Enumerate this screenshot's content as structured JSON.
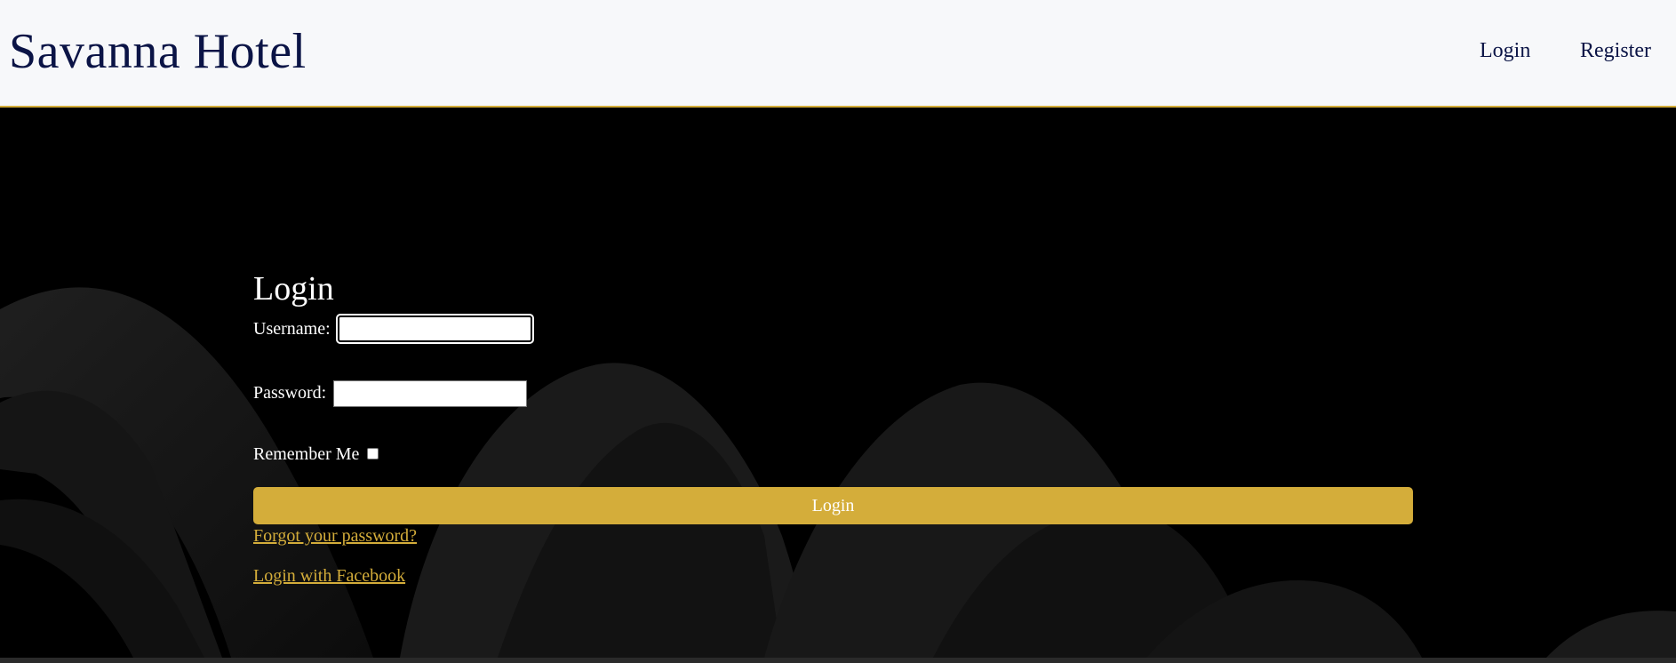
{
  "header": {
    "brand": "Savanna Hotel",
    "nav": {
      "login": "Login",
      "register": "Register"
    }
  },
  "login_form": {
    "title": "Login",
    "username_label": "Username:",
    "username_value": "",
    "password_label": "Password:",
    "password_value": "",
    "remember_label": "Remember Me",
    "remember_checked": false,
    "submit_label": "Login",
    "forgot_link": "Forgot your password?",
    "facebook_link": "Login with Facebook"
  },
  "colors": {
    "accent": "#d4ad3a",
    "brand_text": "#0b1446",
    "header_bg": "#f7f8fa",
    "main_bg": "#000000"
  }
}
